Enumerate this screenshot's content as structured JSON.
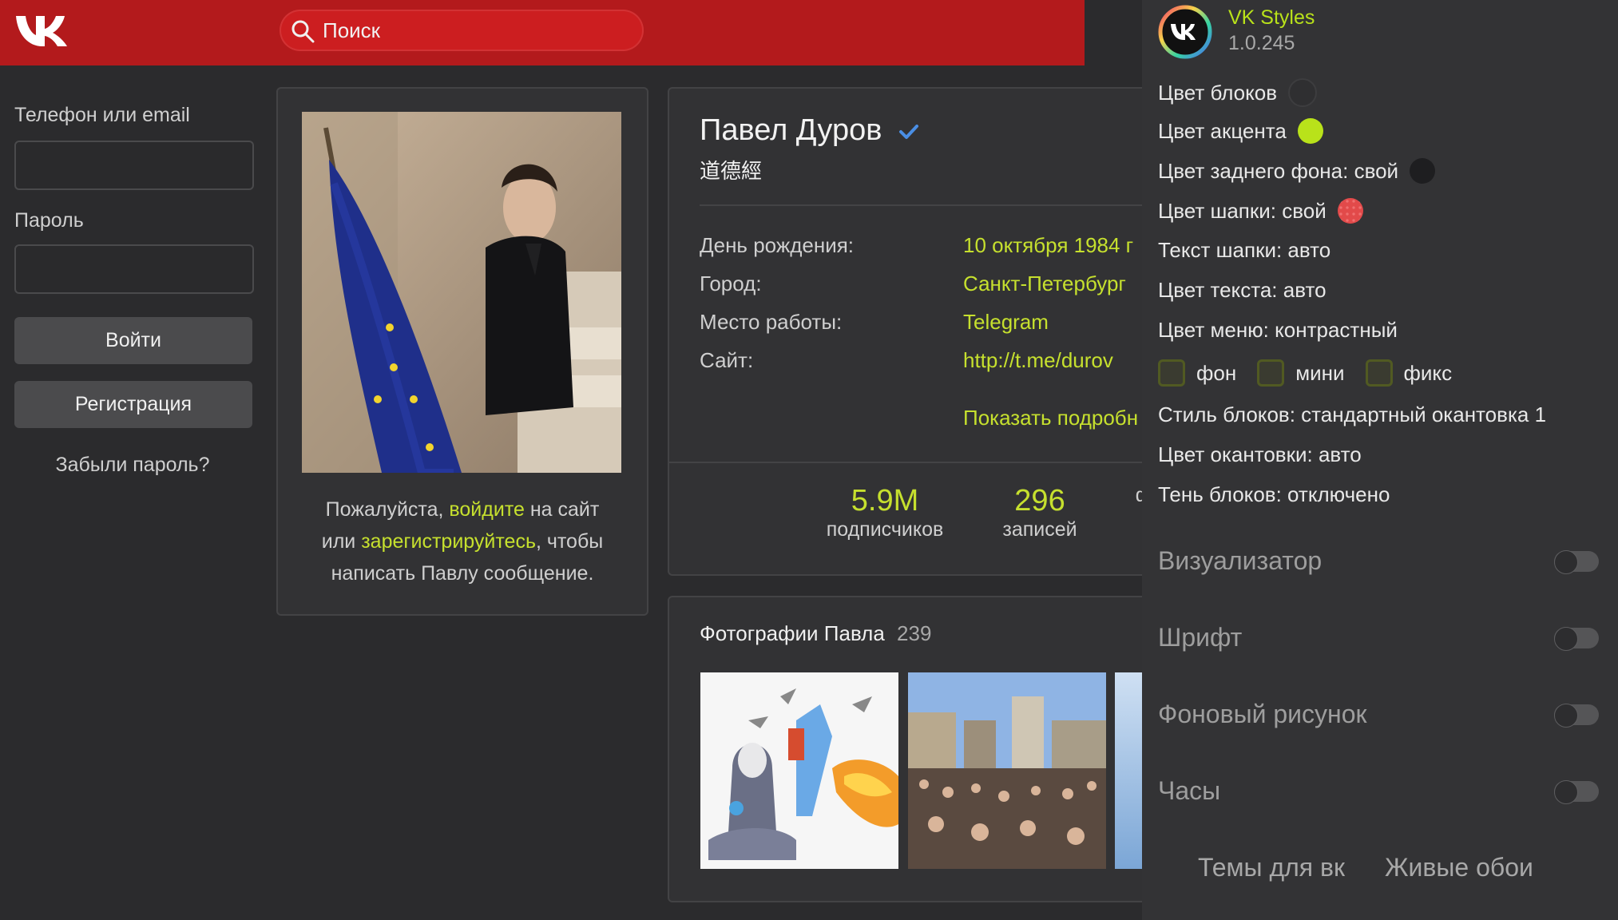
{
  "header": {
    "search_placeholder": "Поиск"
  },
  "login": {
    "phone_label": "Телефон или email",
    "password_label": "Пароль",
    "login_button": "Войти",
    "register_button": "Регистрация",
    "forgot_link": "Забыли пароль?"
  },
  "avatar_card": {
    "msg_part1": "Пожалуйста, ",
    "msg_link1": "войдите",
    "msg_part2": " на сайт",
    "msg_part3": "или ",
    "msg_link2": "зарегистрируйтесь",
    "msg_part4": ", чтобы",
    "msg_part5": "написать Павлу сообщение."
  },
  "profile": {
    "name": "Павел Дуров",
    "status": "道德經",
    "fields": [
      {
        "label": "День рождения:",
        "value": "10 октября 1984 г"
      },
      {
        "label": "Город:",
        "value": "Санкт-Петербург"
      },
      {
        "label": "Место работы:",
        "value": "Telegram"
      },
      {
        "label": "Сайт:",
        "value": "http://t.me/durov"
      }
    ],
    "show_more": "Показать подробн",
    "counters": [
      {
        "value": "5.9M",
        "label": "подписчиков"
      },
      {
        "value": "296",
        "label": "записей"
      },
      {
        "value": "",
        "label": "ф"
      }
    ]
  },
  "photos": {
    "title": "Фотографии Павла",
    "count": "239"
  },
  "panel": {
    "app_name": "VK Styles",
    "version": "1.0.245",
    "options": [
      "Цвет блоков",
      "Цвет акцента",
      "Цвет заднего фона: свой",
      "Цвет шапки: свой",
      "Текст шапки: авто",
      "Цвет текста: авто",
      "Цвет меню: контрастный"
    ],
    "checkboxes": [
      "фон",
      "мини",
      "фикс"
    ],
    "options2": [
      "Стиль блоков: стандартный окантовка 1",
      "Цвет окантовки: авто",
      "Тень блоков: отключено"
    ],
    "sections": [
      "Визуализатор",
      "Шрифт",
      "Фоновый рисунок",
      "Часы"
    ],
    "footer_links": [
      "Темы для вк",
      "Живые обои"
    ],
    "colors": {
      "accent": "#b9e21a",
      "header_red": "#b31a1c",
      "block_color": "#2f2f31",
      "bg_color": "#1e1e20"
    }
  }
}
